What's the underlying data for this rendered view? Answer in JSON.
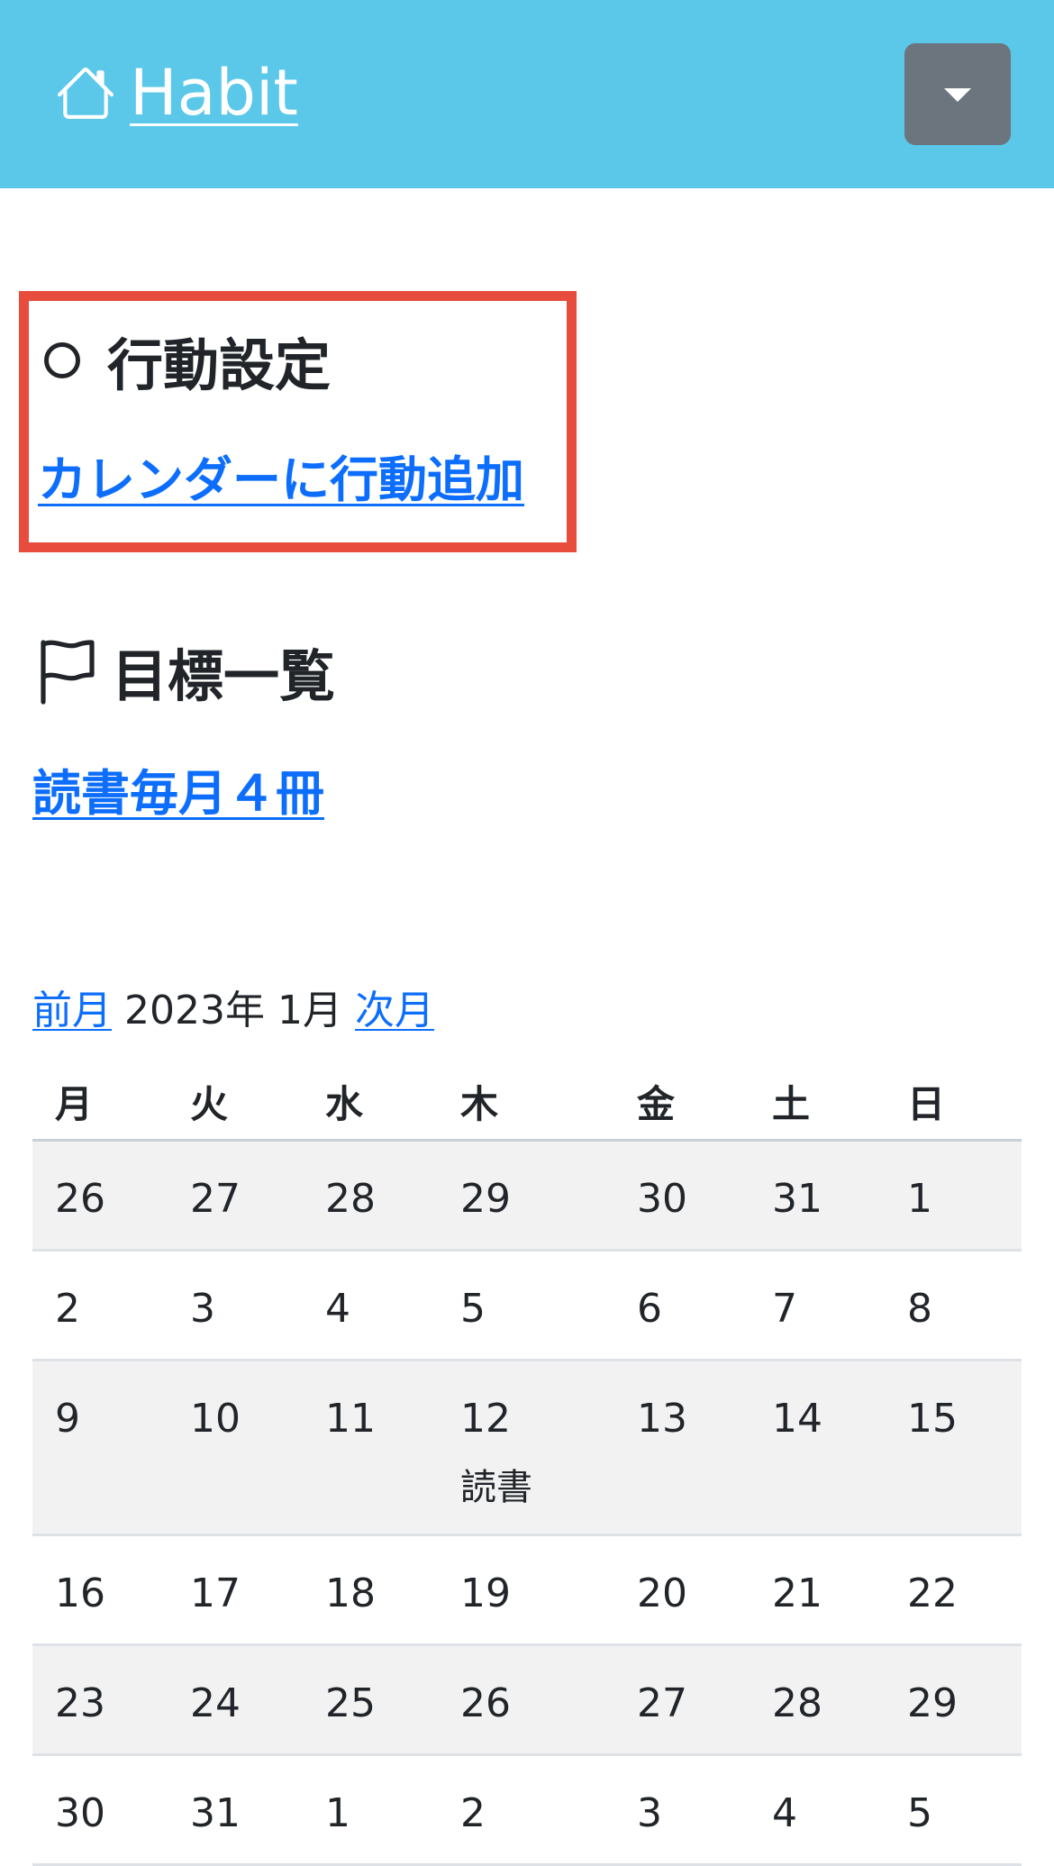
{
  "header": {
    "brand_label": "Habit",
    "brand_icon": "house-icon",
    "menu_icon": "caret-down-icon",
    "bg_color": "#5bc8ea"
  },
  "actions": {
    "title": "行動設定",
    "icon": "circle-icon",
    "add_link": "カレンダーに行動追加",
    "highlight_color": "#e74c3c"
  },
  "goals": {
    "title": "目標一覧",
    "icon": "flag-icon",
    "items": [
      {
        "label": "読書毎月４冊"
      }
    ]
  },
  "calendar": {
    "prev_label": "前月",
    "month_label": "2023年 1月",
    "next_label": "次月",
    "weekdays": [
      "月",
      "火",
      "水",
      "木",
      "金",
      "土",
      "日"
    ],
    "weeks": [
      {
        "days": [
          {
            "d": "26"
          },
          {
            "d": "27"
          },
          {
            "d": "28"
          },
          {
            "d": "29"
          },
          {
            "d": "30"
          },
          {
            "d": "31"
          },
          {
            "d": "1"
          }
        ]
      },
      {
        "days": [
          {
            "d": "2"
          },
          {
            "d": "3"
          },
          {
            "d": "4"
          },
          {
            "d": "5"
          },
          {
            "d": "6"
          },
          {
            "d": "7"
          },
          {
            "d": "8"
          }
        ]
      },
      {
        "days": [
          {
            "d": "9"
          },
          {
            "d": "10"
          },
          {
            "d": "11"
          },
          {
            "d": "12",
            "event": "読書"
          },
          {
            "d": "13"
          },
          {
            "d": "14"
          },
          {
            "d": "15"
          }
        ]
      },
      {
        "days": [
          {
            "d": "16"
          },
          {
            "d": "17"
          },
          {
            "d": "18"
          },
          {
            "d": "19"
          },
          {
            "d": "20"
          },
          {
            "d": "21"
          },
          {
            "d": "22"
          }
        ]
      },
      {
        "days": [
          {
            "d": "23"
          },
          {
            "d": "24"
          },
          {
            "d": "25"
          },
          {
            "d": "26"
          },
          {
            "d": "27"
          },
          {
            "d": "28"
          },
          {
            "d": "29"
          }
        ]
      },
      {
        "days": [
          {
            "d": "30"
          },
          {
            "d": "31"
          },
          {
            "d": "1"
          },
          {
            "d": "2"
          },
          {
            "d": "3"
          },
          {
            "d": "4"
          },
          {
            "d": "5"
          }
        ]
      }
    ]
  }
}
